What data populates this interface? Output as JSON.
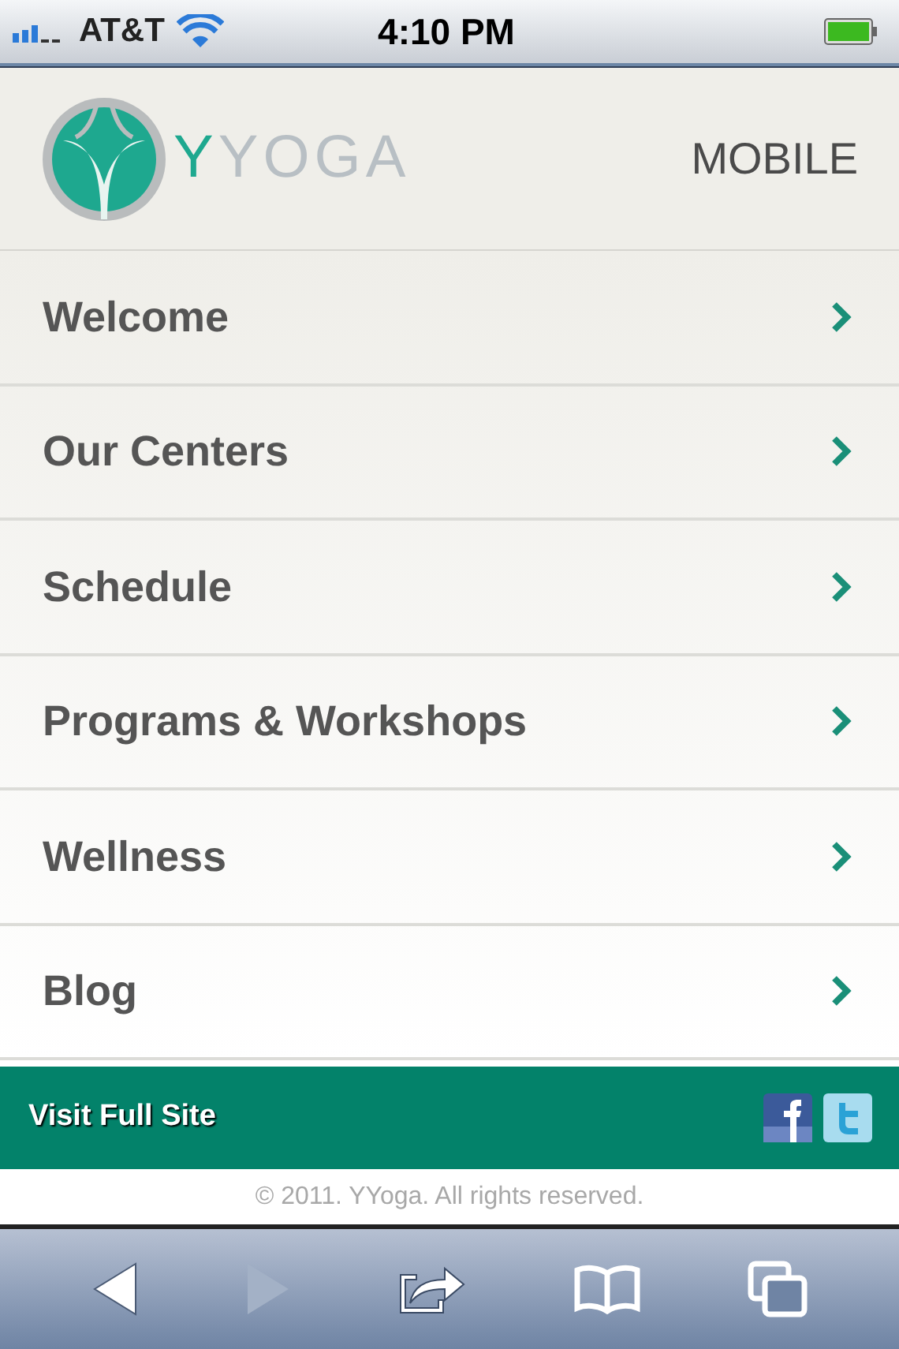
{
  "status_bar": {
    "carrier": "AT&T",
    "time": "4:10 PM"
  },
  "header": {
    "logo": {
      "accent": "Y",
      "rest": "YOGA"
    },
    "label": "MOBILE"
  },
  "menu": [
    {
      "label": "Welcome"
    },
    {
      "label": "Our Centers"
    },
    {
      "label": "Schedule"
    },
    {
      "label": "Programs & Workshops"
    },
    {
      "label": "Wellness"
    },
    {
      "label": "Blog"
    }
  ],
  "footer_bar": {
    "link": "Visit Full Site"
  },
  "copyright": "© 2011. YYoga. All rights reserved.",
  "toolbar": [
    {
      "kind": "back",
      "disabled": false
    },
    {
      "kind": "forward",
      "disabled": true
    },
    {
      "kind": "share",
      "disabled": false
    },
    {
      "kind": "bookmarks",
      "disabled": false
    },
    {
      "kind": "pages",
      "disabled": false
    }
  ]
}
